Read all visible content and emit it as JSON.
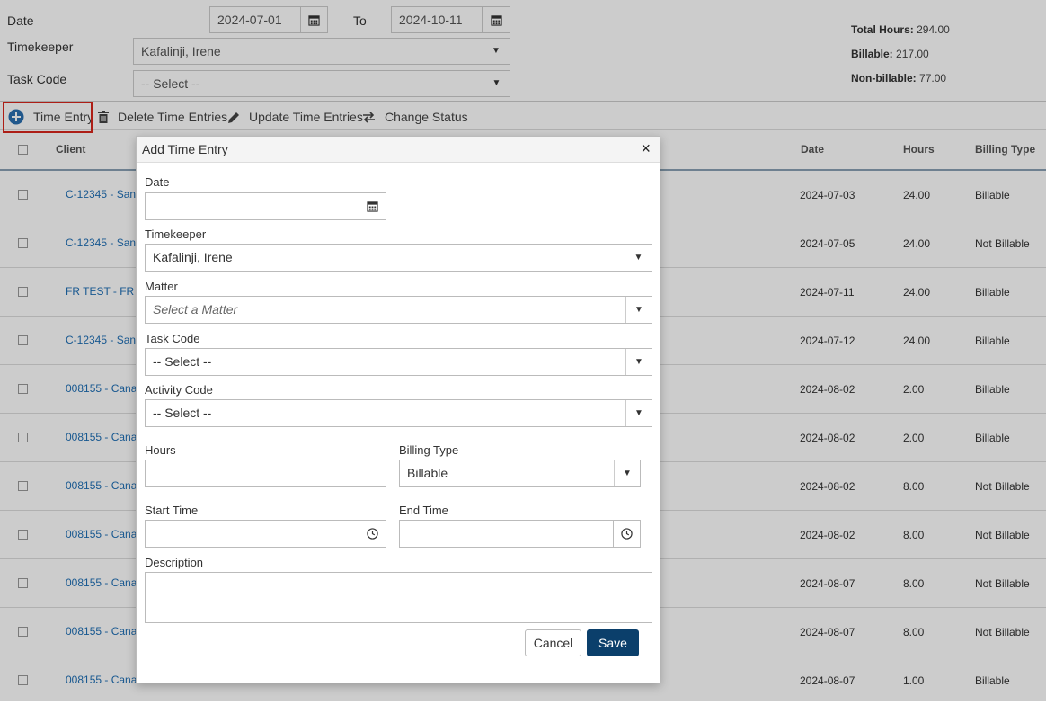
{
  "filters": {
    "date_label": "Date",
    "date_from": "2024-07-01",
    "to_label": "To",
    "date_to": "2024-10-11",
    "timekeeper_label": "Timekeeper",
    "timekeeper_value": "Kafalinji, Irene",
    "task_code_label": "Task Code",
    "task_code_value": "-- Select --"
  },
  "totals": {
    "total_hours_label": "Total Hours:",
    "total_hours_value": "294.00",
    "billable_label": "Billable:",
    "billable_value": "217.00",
    "nonbillable_label": "Non-billable:",
    "nonbillable_value": "77.00"
  },
  "toolbar": {
    "time_entry": "Time Entry",
    "delete": "Delete Time Entries",
    "update": "Update Time Entries",
    "change_status": "Change Status"
  },
  "table": {
    "headers": {
      "client": "Client",
      "date": "Date",
      "hours": "Hours",
      "billing_type": "Billing Type"
    },
    "rows": [
      {
        "client": "C-12345 - San",
        "date": "2024-07-03",
        "hours": "24.00",
        "billing": "Billable"
      },
      {
        "client": "C-12345 - San",
        "date": "2024-07-05",
        "hours": "24.00",
        "billing": "Not Billable"
      },
      {
        "client": "FR TEST - FR",
        "date": "2024-07-11",
        "hours": "24.00",
        "billing": "Billable"
      },
      {
        "client": "C-12345 - San",
        "date": "2024-07-12",
        "hours": "24.00",
        "billing": "Billable"
      },
      {
        "client": "008155 - Cana",
        "date": "2024-08-02",
        "hours": "2.00",
        "billing": "Billable"
      },
      {
        "client": "008155 - Cana",
        "date": "2024-08-02",
        "hours": "2.00",
        "billing": "Billable"
      },
      {
        "client": "008155 - Cana",
        "date": "2024-08-02",
        "hours": "8.00",
        "billing": "Not Billable"
      },
      {
        "client": "008155 - Cana",
        "date": "2024-08-02",
        "hours": "8.00",
        "billing": "Not Billable"
      },
      {
        "client": "008155 - Cana",
        "date": "2024-08-07",
        "hours": "8.00",
        "billing": "Not Billable"
      },
      {
        "client": "008155 - Cana",
        "date": "2024-08-07",
        "hours": "8.00",
        "billing": "Not Billable"
      },
      {
        "client": "008155 - Cana",
        "date": "2024-08-07",
        "hours": "1.00",
        "billing": "Billable"
      }
    ]
  },
  "modal": {
    "title": "Add Time Entry",
    "close": "×",
    "date_label": "Date",
    "date_value": "",
    "timekeeper_label": "Timekeeper",
    "timekeeper_value": "Kafalinji, Irene",
    "matter_label": "Matter",
    "matter_placeholder": "Select a Matter",
    "task_code_label": "Task Code",
    "task_code_value": "-- Select --",
    "activity_code_label": "Activity Code",
    "activity_code_value": "-- Select --",
    "hours_label": "Hours",
    "hours_value": "",
    "billing_type_label": "Billing Type",
    "billing_type_value": "Billable",
    "start_time_label": "Start Time",
    "start_time_value": "",
    "end_time_label": "End Time",
    "end_time_value": "",
    "description_label": "Description",
    "description_value": "",
    "cancel": "Cancel",
    "save": "Save"
  },
  "icons": {
    "calendar": "calendar-icon",
    "clock": "clock-icon",
    "plus": "plus-circle-icon",
    "trash": "trash-icon",
    "pencil": "pencil-icon",
    "exchange": "exchange-icon"
  },
  "colors": {
    "link": "#1f6fb5",
    "save_button": "#0b3f6b",
    "highlight_border": "#d9261c",
    "plus_icon": "#2a6fb0"
  }
}
